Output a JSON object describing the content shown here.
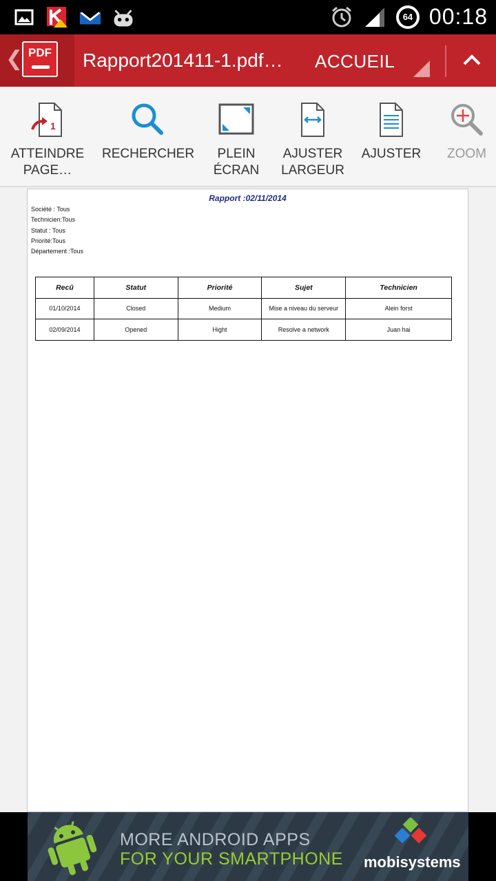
{
  "status_bar": {
    "time": "00:18",
    "battery_level": "64",
    "icons": [
      "image-icon",
      "kaspersky-icon",
      "gmail-icon",
      "cyanogen-icon",
      "alarm-icon",
      "signal-icon",
      "battery-icon"
    ]
  },
  "app_bar": {
    "title": "Rapport201411-1.pdf…",
    "tab": "ACCUEIL",
    "logo_text": "PDF",
    "accent": "#c0242b"
  },
  "toolbar": {
    "items": [
      {
        "icon": "goto-page-icon",
        "label_line1": "ATTEINDRE",
        "label_line2": "PAGE…"
      },
      {
        "icon": "search-icon",
        "label_line1": "RECHERCHER",
        "label_line2": ""
      },
      {
        "icon": "fullscreen-icon",
        "label_line1": "PLEIN",
        "label_line2": "ÉCRAN"
      },
      {
        "icon": "fit-width-icon",
        "label_line1": "AJUSTER",
        "label_line2": "LARGEUR"
      },
      {
        "icon": "fit-page-icon",
        "label_line1": "AJUSTER",
        "label_line2": ""
      },
      {
        "icon": "zoom-icon",
        "label_line1": "ZOOM",
        "label_line2": ""
      }
    ]
  },
  "document": {
    "title": "Rapport :02/11/2014",
    "filters": [
      "Société : Tous",
      "Technicien:Tous",
      "Statut : Tous",
      "Priorité:Tous",
      "Département :Tous"
    ],
    "table": {
      "headers": [
        "Recû",
        "Statut",
        "Priorité",
        "Sujet",
        "Technicien"
      ],
      "rows": [
        [
          "01/10/2014",
          "Closed",
          "Medium",
          "Mise a niveau du serveur",
          "Alein forst"
        ],
        [
          "02/09/2014",
          "Opened",
          "Hight",
          "Resolve a network",
          "Juan hai"
        ]
      ]
    }
  },
  "ad_banner": {
    "line1": "MORE ANDROID APPS",
    "line2": "FOR YOUR SMARTPHONE",
    "brand": "mobisystems"
  }
}
